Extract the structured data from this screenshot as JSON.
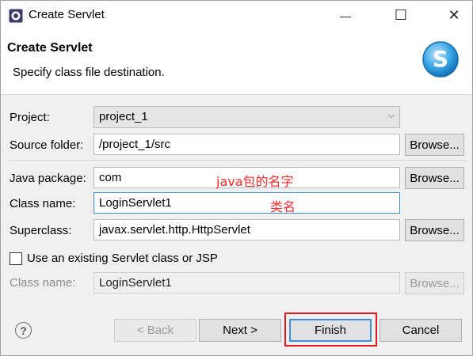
{
  "window": {
    "title": "Create Servlet",
    "minimize_glyph": "—",
    "maximize_glyph": "☐",
    "close_glyph": "✕"
  },
  "header": {
    "title": "Create Servlet",
    "description": "Specify class file destination.",
    "logo_icon": "servlet-wizard-s-icon"
  },
  "form": {
    "project_label": "Project:",
    "project_value": "project_1",
    "source_folder_label": "Source folder:",
    "source_folder_value": "/project_1/src",
    "java_package_label": "Java package:",
    "java_package_value": "com",
    "class_name_label": "Class name:",
    "class_name_value": "LoginServlet1",
    "superclass_label": "Superclass:",
    "superclass_value": "javax.servlet.http.HttpServlet",
    "browse_label": "Browse...",
    "existing_checkbox_label": "Use an existing Servlet class or JSP",
    "existing_checked": false,
    "existing_class_name_label": "Class name:",
    "existing_class_name_value": "LoginServlet1"
  },
  "annotations": {
    "package_note": "java包的名字",
    "class_note": "类名"
  },
  "buttons": {
    "back": "< Back",
    "next": "Next >",
    "finish": "Finish",
    "cancel": "Cancel",
    "help": "?"
  },
  "colors": {
    "accent": "#3c8fd8",
    "annotation_red": "#ff2a2a",
    "highlight_red": "#e8161c"
  }
}
